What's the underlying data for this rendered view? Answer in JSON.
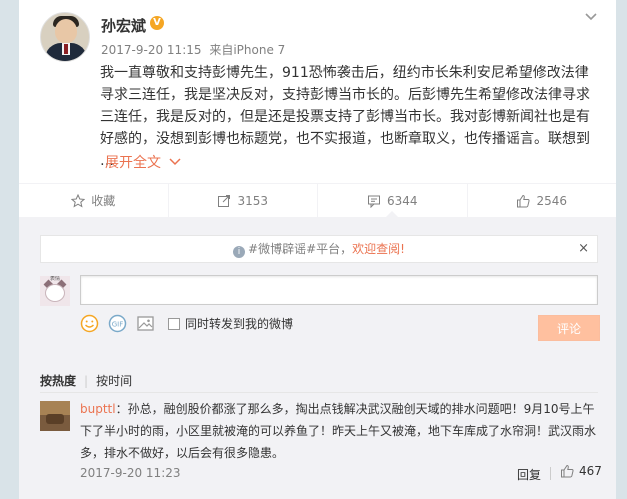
{
  "post": {
    "username": "孙宏斌",
    "verified_badge": "V",
    "time": "2017-9-20 11:15",
    "source_prefix": "来自",
    "source": "iPhone 7",
    "text": "我一直尊敬和支持彭博先生，911恐怖袭击后，纽约市长朱利安尼希望修改法律寻求三连任，我是坚决反对，支持彭博当市长的。后彭博先生希望修改法律寻求三连任，我是反对的，但是还是投票支持了彭博当市长。我对彭博新闻社也是有好感的，没想到彭博也标题党，也不实报道，也断章取义，也传播谣言。联想到 …",
    "expand_label": "展开全文",
    "expand_icon": "chevron-down-icon"
  },
  "actions": {
    "favorite": {
      "label": "收藏",
      "icon": "star-icon"
    },
    "repost": {
      "count": "3153",
      "icon": "share-icon"
    },
    "comment": {
      "count": "6344",
      "icon": "comment-icon"
    },
    "like": {
      "count": "2546",
      "icon": "thumb-up-icon"
    }
  },
  "notice": {
    "prefix": "#微博辟谣#平台，",
    "highlight": "欢迎查阅!",
    "close": "×"
  },
  "composer": {
    "my_avatar_caption": "表情",
    "placeholder": "",
    "repost_label": "同时转发到我的微博",
    "submit_label": "评论",
    "tools": [
      "smile-icon",
      "gif-icon",
      "image-icon"
    ]
  },
  "sort": {
    "hot": "按热度",
    "time": "按时间"
  },
  "comments": [
    {
      "user": "bupttl",
      "text": "：孙总，融创股价都涨了那么多，掏出点钱解决武汉融创天域的排水问题吧！9月10号上午下了半小时的雨，小区里就被淹的可以养鱼了！昨天上午又被淹，地下车库成了水帘洞！武汉雨水多，排水不做好，以后会有很多隐患。",
      "time": "2017-9-20 11:23",
      "reply_label": "回复",
      "likes": "467"
    }
  ],
  "colors": {
    "accent": "#eb7350",
    "badge": "#f5a623",
    "page_bg": "#d9e3e8",
    "comment_bg": "#f2f2f5"
  }
}
